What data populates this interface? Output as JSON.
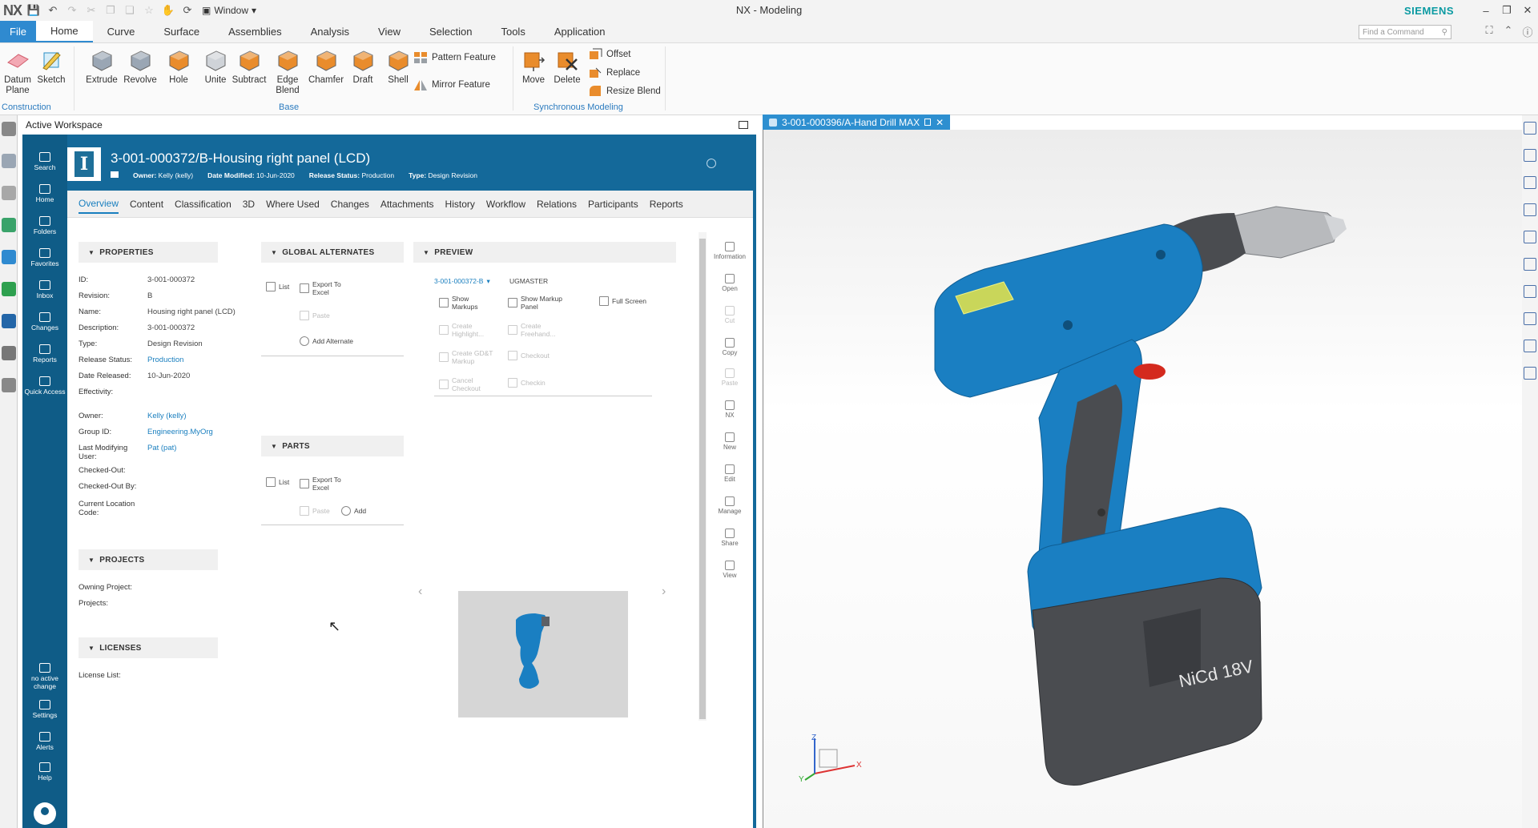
{
  "titlebar": {
    "logo": "NX",
    "window_menu": "Window",
    "app_title": "NX - Modeling",
    "brand": "SIEMENS"
  },
  "ribbon_tabs": [
    "File",
    "Home",
    "Curve",
    "Surface",
    "Assemblies",
    "Analysis",
    "View",
    "Selection",
    "Tools",
    "Application"
  ],
  "find_command_placeholder": "Find a Command",
  "ribbon": {
    "construction": {
      "datum_plane": "Datum Plane",
      "sketch": "Sketch",
      "label": "Construction"
    },
    "base": {
      "buttons": [
        "Extrude",
        "Revolve",
        "Hole",
        "Unite",
        "Subtract",
        "Edge Blend",
        "Chamfer",
        "Draft",
        "Shell"
      ],
      "pattern_feature": "Pattern Feature",
      "mirror_feature": "Mirror Feature",
      "label": "Base"
    },
    "sync": {
      "move": "Move",
      "delete": "Delete",
      "offset": "Offset",
      "replace": "Replace",
      "resize_blend": "Resize Blend",
      "label": "Synchronous Modeling"
    }
  },
  "workspace": {
    "title": "Active Workspace",
    "nav": [
      {
        "label": "Search",
        "icon": "search-icon"
      },
      {
        "label": "Home",
        "icon": "home-icon"
      },
      {
        "label": "Folders",
        "icon": "folder-icon"
      },
      {
        "label": "Favorites",
        "icon": "star-icon"
      },
      {
        "label": "Inbox",
        "icon": "inbox-icon"
      },
      {
        "label": "Changes",
        "icon": "changes-icon"
      },
      {
        "label": "Reports",
        "icon": "reports-icon"
      },
      {
        "label": "Quick Access",
        "icon": "quick-access-icon"
      }
    ],
    "nav_bottom": [
      {
        "label": "no active change",
        "icon": "change-icon"
      },
      {
        "label": "Settings",
        "icon": "gear-icon"
      },
      {
        "label": "Alerts",
        "icon": "bell-icon"
      },
      {
        "label": "Help",
        "icon": "help-icon"
      }
    ],
    "object": {
      "icon_letter": "I",
      "title": "3-001-000372/B-Housing right panel (LCD)",
      "owner_label": "Owner:",
      "owner_value": "Kelly (kelly)",
      "date_label": "Date Modified:",
      "date_value": "10-Jun-2020",
      "release_label": "Release Status:",
      "release_value": "Production",
      "type_label": "Type:",
      "type_value": "Design Revision"
    },
    "tabs": [
      "Overview",
      "Content",
      "Classification",
      "3D",
      "Where Used",
      "Changes",
      "Attachments",
      "History",
      "Workflow",
      "Relations",
      "Participants",
      "Reports"
    ],
    "properties": {
      "header": "PROPERTIES",
      "rows": [
        {
          "label": "ID:",
          "value": "3-001-000372"
        },
        {
          "label": "Revision:",
          "value": "B"
        },
        {
          "label": "Name:",
          "value": "Housing right panel (LCD)"
        },
        {
          "label": "Description:",
          "value": "3-001-000372"
        },
        {
          "label": "Type:",
          "value": "Design Revision"
        },
        {
          "label": "Release Status:",
          "value": "Production"
        },
        {
          "label": "Date Released:",
          "value": "10-Jun-2020"
        },
        {
          "label": "Effectivity:",
          "value": ""
        },
        {
          "label": "Owner:",
          "value": "Kelly (kelly)"
        },
        {
          "label": "Group ID:",
          "value": "Engineering.MyOrg"
        },
        {
          "label": "Last Modifying User:",
          "value": "Pat (pat)"
        },
        {
          "label": "Checked-Out:",
          "value": ""
        },
        {
          "label": "Checked-Out By:",
          "value": ""
        },
        {
          "label": "Current Location Code:",
          "value": ""
        }
      ]
    },
    "projects": {
      "header": "PROJECTS",
      "owning_project": "Owning Project:",
      "projects": "Projects:"
    },
    "licenses": {
      "header": "LICENSES",
      "license_list": "License List:"
    },
    "global_alternates": {
      "header": "GLOBAL ALTERNATES",
      "list": "List",
      "export": "Export To Excel",
      "paste": "Paste",
      "add_alternate": "Add Alternate"
    },
    "parts": {
      "header": "PARTS",
      "list": "List",
      "export": "Export To Excel",
      "paste": "Paste",
      "add": "Add"
    },
    "preview": {
      "header": "PREVIEW",
      "dataset": "3-001-000372-B",
      "ugmaster": "UGMASTER",
      "show_markups": "Show Markups",
      "show_markup_panel": "Show Markup Panel",
      "full_screen": "Full Screen",
      "create_highlight": "Create Highlight...",
      "create_freehand": "Create Freehand...",
      "create_gdt": "Create GD&T Markup",
      "checkout": "Checkout",
      "cancel_checkout": "Cancel Checkout",
      "checkin": "Checkin"
    },
    "right_toolbar": [
      "Information",
      "Open",
      "Cut",
      "Copy",
      "Paste",
      "NX",
      "New",
      "Edit",
      "Manage",
      "Share",
      "View"
    ]
  },
  "graphics": {
    "tab_label": "3-001-000396/A-Hand Drill MAX",
    "battery_label": "NiCd 18V",
    "axes": {
      "x": "X",
      "y": "Y",
      "z": "Z"
    }
  },
  "colors": {
    "accent": "#2f8ad0",
    "aw_blue": "#14699a",
    "drill_blue": "#1a7fc2",
    "drill_gray": "#4a4c50"
  }
}
